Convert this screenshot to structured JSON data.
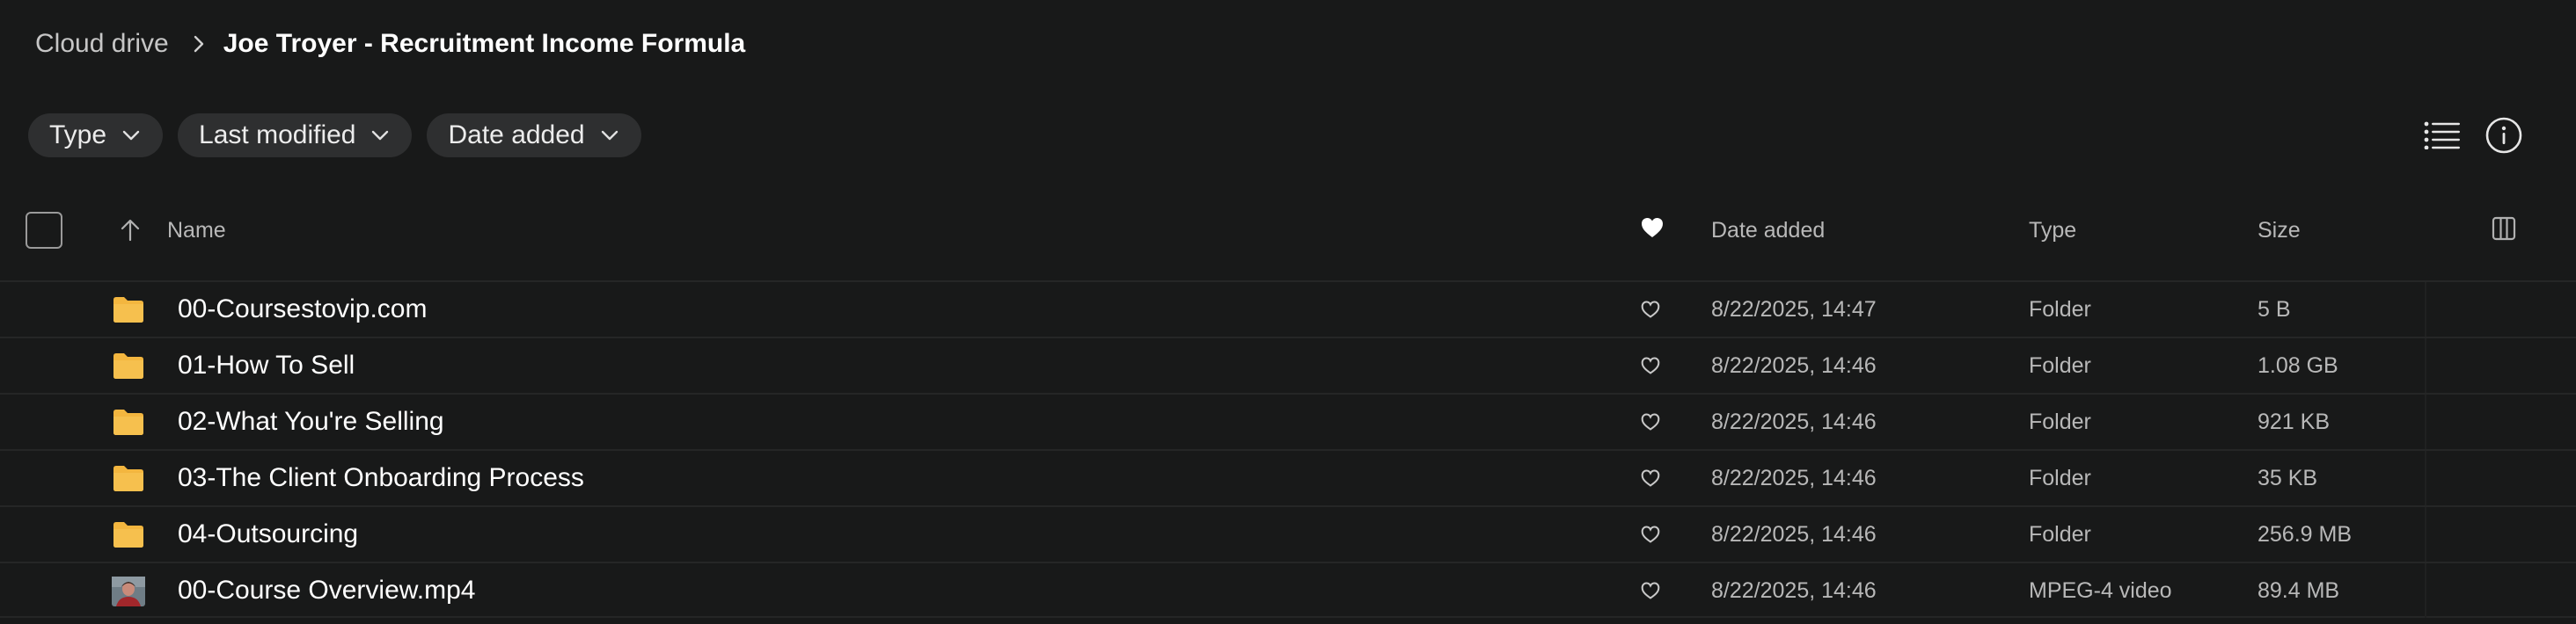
{
  "breadcrumb": {
    "root": "Cloud drive",
    "current": "Joe Troyer - Recruitment Income Formula"
  },
  "filters": [
    {
      "label": "Type"
    },
    {
      "label": "Last modified"
    },
    {
      "label": "Date added"
    }
  ],
  "table": {
    "columns": {
      "name": "Name",
      "date_added": "Date added",
      "type": "Type",
      "size": "Size"
    },
    "rows": [
      {
        "icon": "folder-icon",
        "name": "00-Coursestovip.com",
        "date_added": "8/22/2025, 14:47",
        "type": "Folder",
        "size": "5 B"
      },
      {
        "icon": "folder-icon",
        "name": "01-How To Sell",
        "date_added": "8/22/2025, 14:46",
        "type": "Folder",
        "size": "1.08 GB"
      },
      {
        "icon": "folder-icon",
        "name": "02-What You're Selling",
        "date_added": "8/22/2025, 14:46",
        "type": "Folder",
        "size": "921 KB"
      },
      {
        "icon": "folder-icon",
        "name": "03-The Client Onboarding Process",
        "date_added": "8/22/2025, 14:46",
        "type": "Folder",
        "size": "35 KB"
      },
      {
        "icon": "folder-icon",
        "name": "04-Outsourcing",
        "date_added": "8/22/2025, 14:46",
        "type": "Folder",
        "size": "256.9 MB"
      },
      {
        "icon": "video-thumbnail",
        "name": "00-Course Overview.mp4",
        "date_added": "8/22/2025, 14:46",
        "type": "MPEG-4 video",
        "size": "89.4 MB"
      }
    ]
  },
  "colors": {
    "background": "#181919",
    "chip": "#2e2f30",
    "folder": "#f3b63f",
    "text_primary": "#ffffff",
    "text_secondary": "#b8b8b8"
  }
}
